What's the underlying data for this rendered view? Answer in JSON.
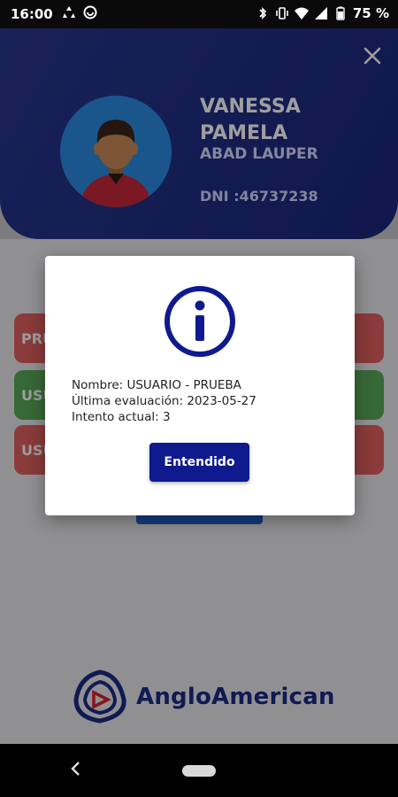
{
  "status_bar": {
    "time": "16:00",
    "battery": "75 %",
    "icons": [
      "recycle-icon",
      "vpn-icon",
      "bluetooth-icon",
      "vibrate-icon",
      "wifi-icon",
      "signal-icon",
      "battery-icon"
    ]
  },
  "profile": {
    "first_names": "VANESSA PAMELA",
    "last_names": "ABAD LAUPER",
    "dni": "DNI :46737238",
    "avatar_bg": "#2a8be3"
  },
  "background_buttons": [
    {
      "label": "PRU",
      "color": "#e06060"
    },
    {
      "label": "USU",
      "color": "#5aa85a"
    },
    {
      "label": "USU",
      "color": "#e06060"
    }
  ],
  "brand": {
    "name": "AngloAmerican",
    "color": "#1b2a86"
  },
  "dialog": {
    "line1": "Nombre: USUARIO - PRUEBA",
    "line2": "Última evaluación: 2023-05-27",
    "line3": "Intento actual: 3",
    "button": "Entendido",
    "accent": "#0f1a8f"
  }
}
